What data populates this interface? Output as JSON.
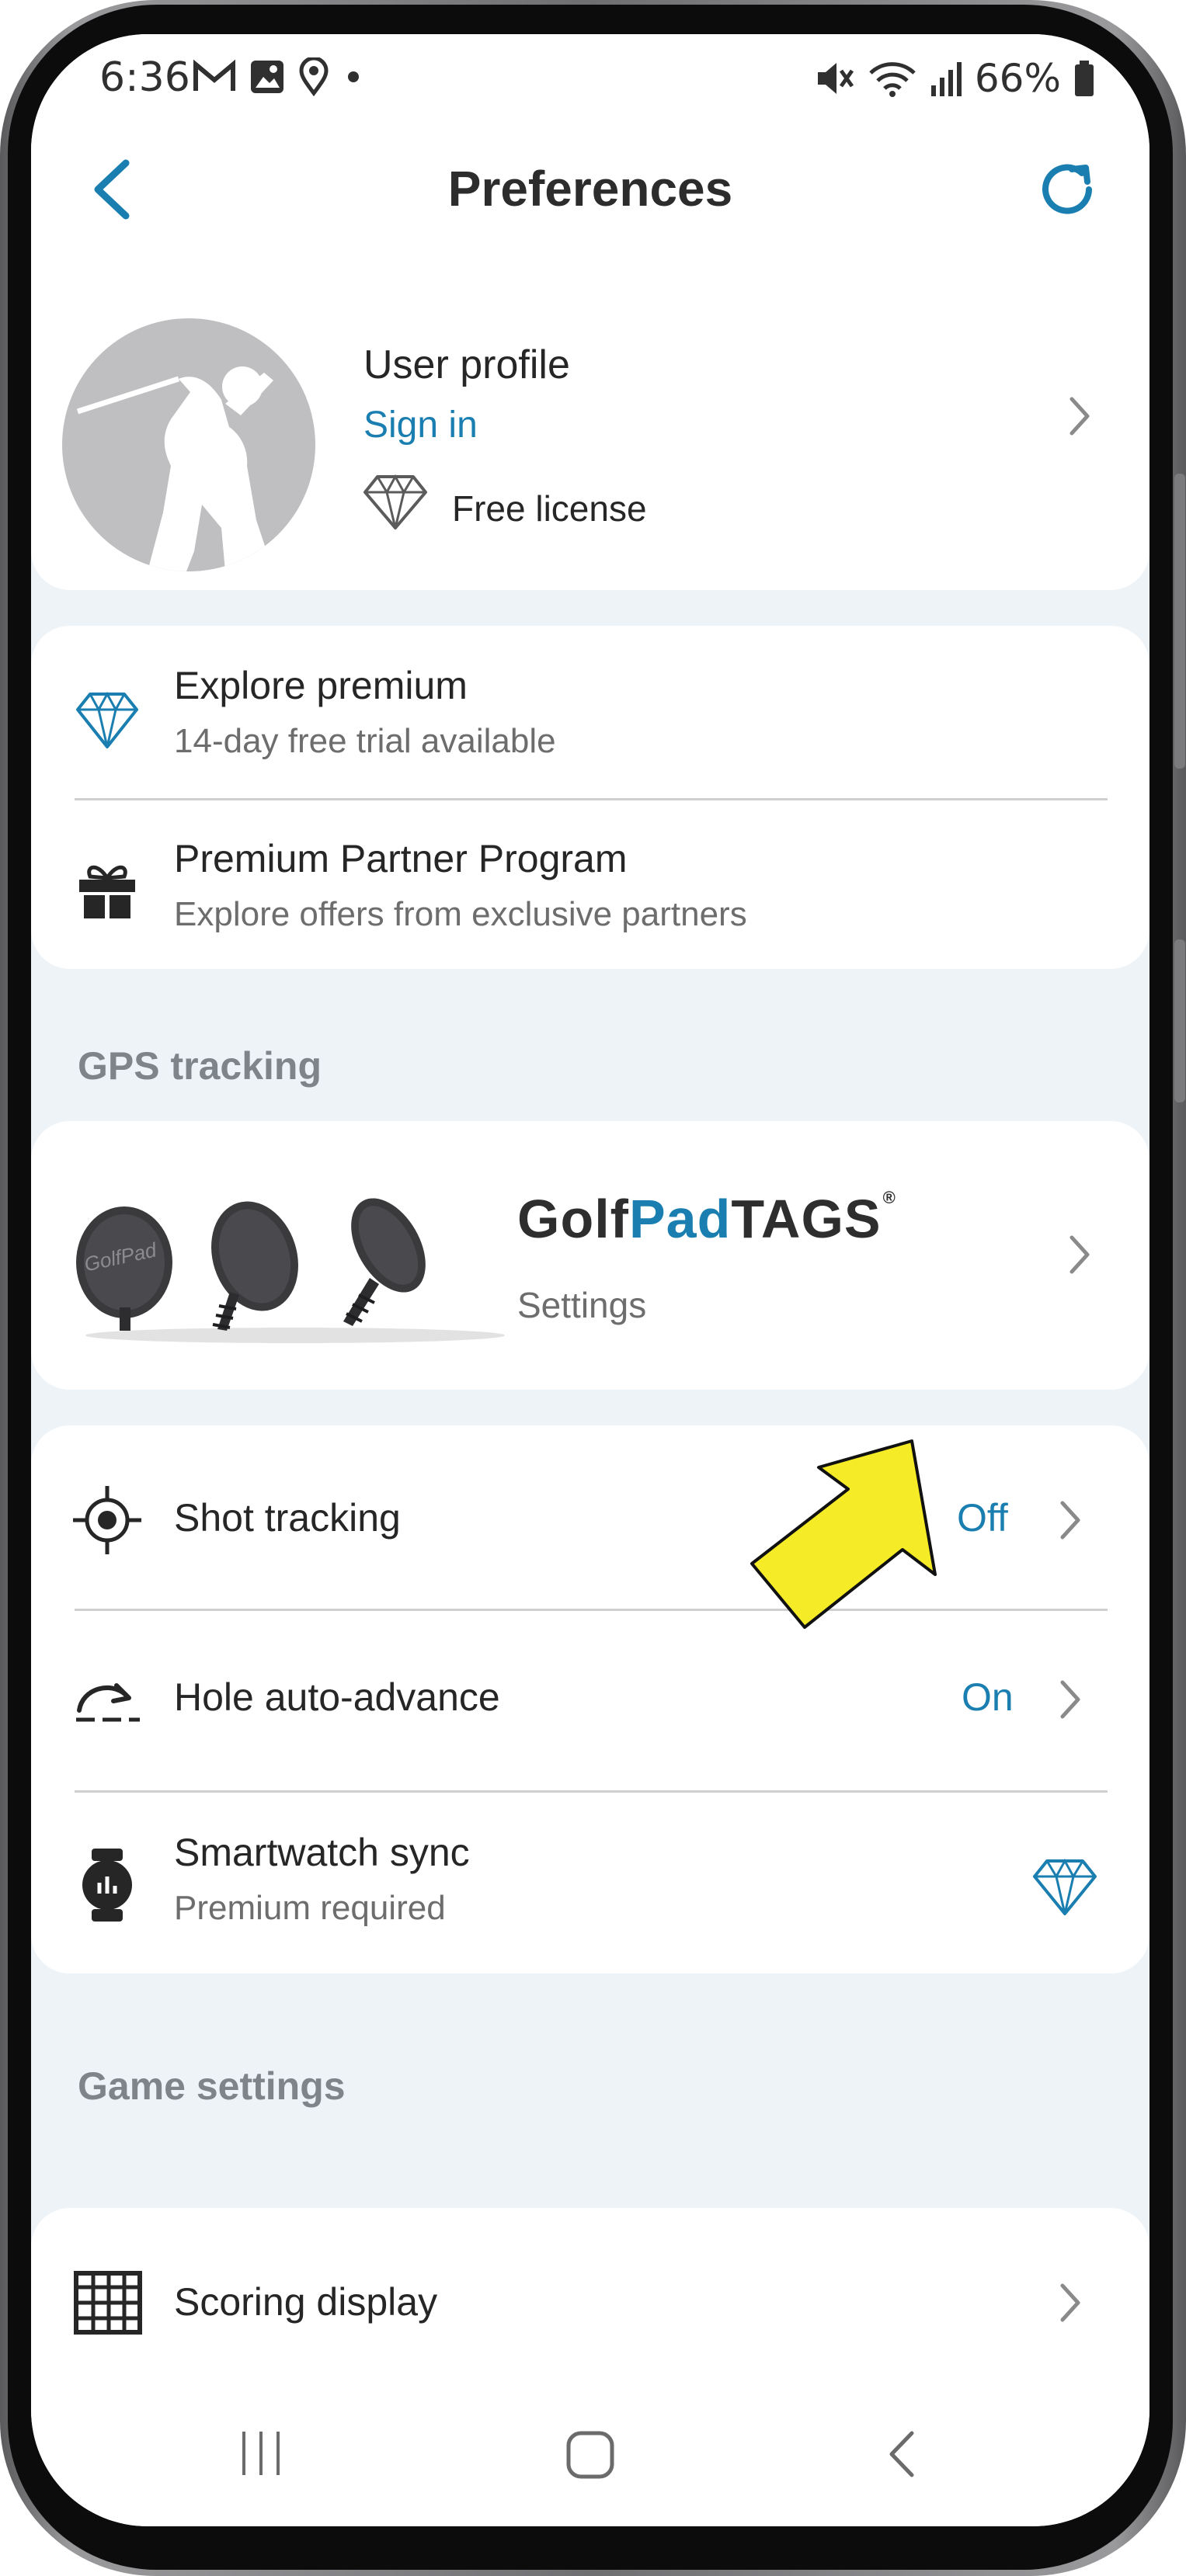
{
  "status_bar": {
    "time": "6:36",
    "battery": "66%"
  },
  "app_bar": {
    "title": "Preferences"
  },
  "profile": {
    "title": "User profile",
    "sign_in": "Sign in",
    "license": "Free license"
  },
  "premium": {
    "explore_title": "Explore premium",
    "explore_sub": "14-day free trial available",
    "partner_title": "Premium Partner Program",
    "partner_sub": "Explore offers from exclusive partners"
  },
  "gps_section": {
    "header": "GPS tracking"
  },
  "tags": {
    "logo_golf": "Golf",
    "logo_pad": "Pad",
    "logo_tags": "TAGS",
    "logo_tm": "®",
    "settings": "Settings",
    "product_label": "GolfPad"
  },
  "tracking": {
    "shot_title": "Shot tracking",
    "shot_value": "Off",
    "hole_title": "Hole auto-advance",
    "hole_value": "On",
    "watch_title": "Smartwatch sync",
    "watch_sub": "Premium required"
  },
  "game_section": {
    "header": "Game settings",
    "scoring_title": "Scoring display"
  },
  "icons": {
    "back": "chevron-left-icon",
    "refresh": "refresh-icon",
    "license": "diamond-outline-icon",
    "premium": "diamond-icon",
    "partner": "gift-icon",
    "shot": "crosshair-icon",
    "hole": "auto-advance-icon",
    "watch": "smartwatch-icon",
    "scoring": "grid-icon"
  },
  "colors": {
    "accent": "#1a7fb0",
    "background": "#eef3f7",
    "card": "#ffffff",
    "arrow": "#f5ec27"
  }
}
